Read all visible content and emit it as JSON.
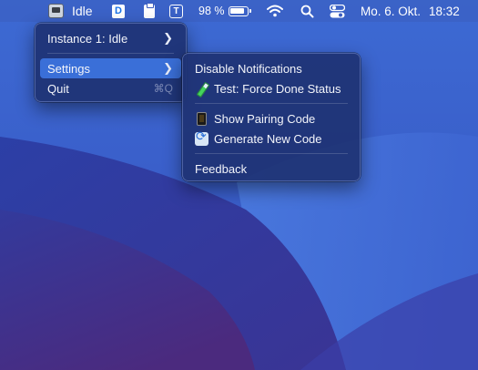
{
  "menubar": {
    "idle_label": "Idle",
    "d_icon_letter": "D",
    "t_icon_letter": "T",
    "battery_percent": "98 %",
    "date": "Mo. 6. Okt.",
    "time": "18:32"
  },
  "main_menu": {
    "items": [
      {
        "label": "Instance 1: Idle",
        "has_submenu": true
      },
      {
        "label": "Settings",
        "has_submenu": true,
        "highlighted": true
      },
      {
        "label": "Quit",
        "shortcut": "⌘Q"
      }
    ]
  },
  "settings_submenu": {
    "items": [
      {
        "label": "Disable Notifications"
      },
      {
        "label": "Test: Force Done Status",
        "icon": "test-tube-icon"
      },
      {
        "label": "Show Pairing Code",
        "icon": "phone-icon"
      },
      {
        "label": "Generate New Code",
        "icon": "refresh-icon"
      },
      {
        "label": "Feedback"
      }
    ]
  },
  "colors": {
    "highlight": "#3a6fd8",
    "menu_background": "#1e3273",
    "wallpaper_top": "#3a5fc9",
    "wallpaper_bottom": "#4a2a86"
  }
}
